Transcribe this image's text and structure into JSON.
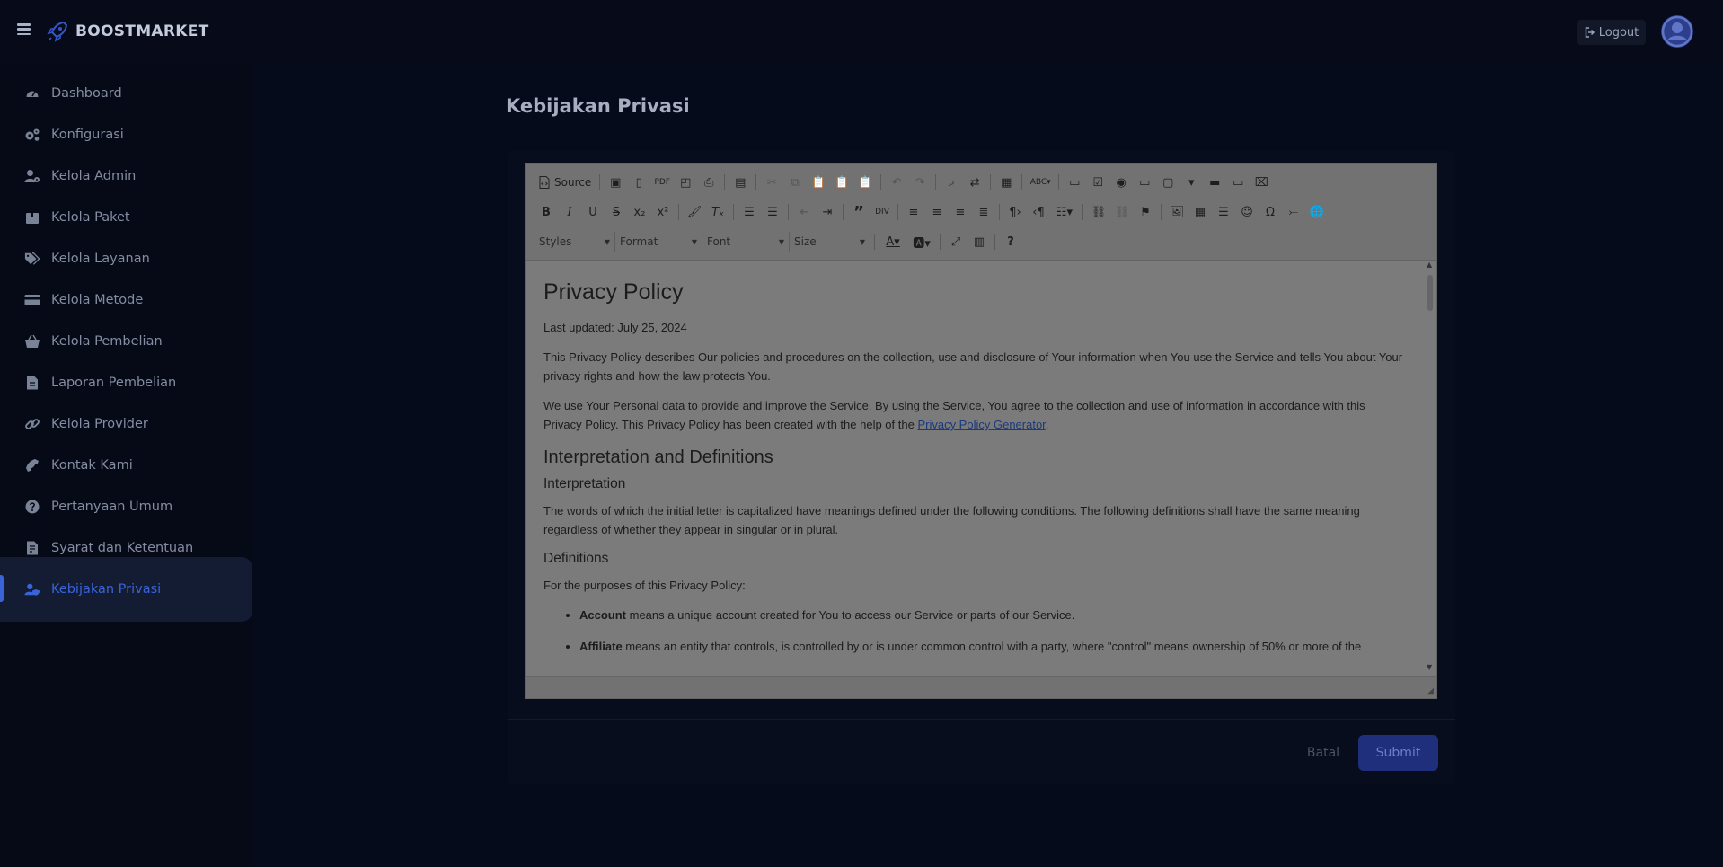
{
  "app": {
    "brand": "BOOSTMARKET",
    "logout_label": "Logout"
  },
  "sidebar": {
    "items": [
      {
        "label": "Dashboard",
        "icon": "dashboard-icon"
      },
      {
        "label": "Konfigurasi",
        "icon": "cogs-icon"
      },
      {
        "label": "Kelola Admin",
        "icon": "user-cog-icon"
      },
      {
        "label": "Kelola Paket",
        "icon": "box-icon"
      },
      {
        "label": "Kelola Layanan",
        "icon": "tags-icon"
      },
      {
        "label": "Kelola Metode",
        "icon": "credit-card-icon"
      },
      {
        "label": "Kelola Pembelian",
        "icon": "basket-icon"
      },
      {
        "label": "Laporan Pembelian",
        "icon": "file-icon"
      },
      {
        "label": "Kelola Provider",
        "icon": "link-icon"
      },
      {
        "label": "Kontak Kami",
        "icon": "phone-icon"
      },
      {
        "label": "Pertanyaan Umum",
        "icon": "question-circle-icon"
      },
      {
        "label": "Syarat dan Ketentuan",
        "icon": "file-contract-icon"
      },
      {
        "label": "Kebijakan Privasi",
        "icon": "user-shield-icon",
        "active": true
      }
    ]
  },
  "page": {
    "title": "Kebijakan Privasi"
  },
  "editor": {
    "toolbar": {
      "source_label": "Source",
      "styles_label": "Styles",
      "format_label": "Format",
      "font_label": "Font",
      "size_label": "Size"
    },
    "content": {
      "h1": "Privacy Policy",
      "updated": "Last updated: July 25, 2024",
      "p1": "This Privacy Policy describes Our policies and procedures on the collection, use and disclosure of Your information when You use the Service and tells You about Your privacy rights and how the law protects You.",
      "p2_prefix": "We use Your Personal data to provide and improve the Service. By using the Service, You agree to the collection and use of information in accordance with this Privacy Policy. This Privacy Policy has been created with the help of the ",
      "p2_link": "Privacy Policy Generator",
      "p2_suffix": ".",
      "h2": "Interpretation and Definitions",
      "h3a": "Interpretation",
      "p3": "The words of which the initial letter is capitalized have meanings defined under the following conditions. The following definitions shall have the same meaning regardless of whether they appear in singular or in plural.",
      "h3b": "Definitions",
      "p4": "For the purposes of this Privacy Policy:",
      "li1_term": "Account",
      "li1_text": " means a unique account created for You to access our Service or parts of our Service.",
      "li2_term": "Affiliate",
      "li2_text": " means an entity that controls, is controlled by or is under common control with a party, where \"control\" means ownership of 50% or more of the"
    }
  },
  "actions": {
    "cancel_label": "Batal",
    "submit_label": "Submit"
  }
}
